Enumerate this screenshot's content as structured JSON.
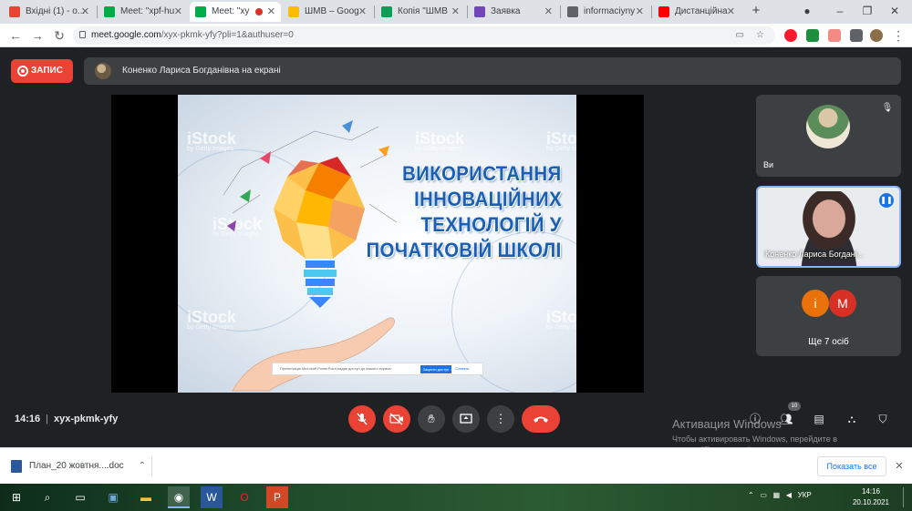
{
  "browser": {
    "tabs": [
      {
        "label": "Вхідні (1) - o...",
        "favicon_color": "#ea4335"
      },
      {
        "label": "Meet: \"xpf-hu",
        "favicon_color": "#00ac47"
      },
      {
        "label": "Meet: \"xy",
        "favicon_color": "#00ac47",
        "active": true
      },
      {
        "label": "ШМВ – Goog",
        "favicon_color": "#fbbc04"
      },
      {
        "label": "Копія \"ШМВ",
        "favicon_color": "#0f9d58"
      },
      {
        "label": "Заявка",
        "favicon_color": "#7248b9"
      },
      {
        "label": "informaciyny",
        "favicon_color": "#5f6368"
      },
      {
        "label": "Дистанційна",
        "favicon_color": "#ff0000"
      }
    ],
    "new_tab": "+",
    "url_host": "meet.google.com",
    "url_path": "/xyx-pkmk-yfy?pli=1&authuser=0"
  },
  "meet": {
    "record_label": "ЗАПИС",
    "presenting_text": "Коненко Лариса Богданівна на екрані",
    "slide": {
      "title_lines": [
        "ВИКОРИСТАННЯ",
        "ІННОВАЦІЙНИХ",
        "ТЕХНОЛОГІЙ У",
        "ПОЧАТКОВІЙ ШКОЛІ"
      ],
      "watermark": "iStock",
      "watermark_sub": "by Getty Images",
      "banner_text": "Презентація Microsoft PowerPoint надає доступ до вашого екрана",
      "banner_btn": "Закрити доступ",
      "banner_link": "Сховати"
    },
    "tiles": {
      "you_label": "Ви",
      "speaker_label": "Коненко Лариса Богдані...",
      "more_label": "Ще 7 осіб",
      "more_avatars": [
        {
          "letter": "і",
          "color": "#e8710a"
        },
        {
          "letter": "М",
          "color": "#d93025"
        }
      ]
    },
    "time": "14:16",
    "meeting_code": "xyx-pkmk-yfy",
    "people_count": "10"
  },
  "watermark": {
    "line1": "Активация Windows",
    "line2": "Чтобы активировать Windows, перейдите в",
    "line3": "раздел \"Параметры\"."
  },
  "downloads": {
    "file": "План_20 жовтня....doc",
    "show_all": "Показать все"
  },
  "taskbar": {
    "lang": "УКР",
    "time": "14:16",
    "date": "20.10.2021"
  }
}
